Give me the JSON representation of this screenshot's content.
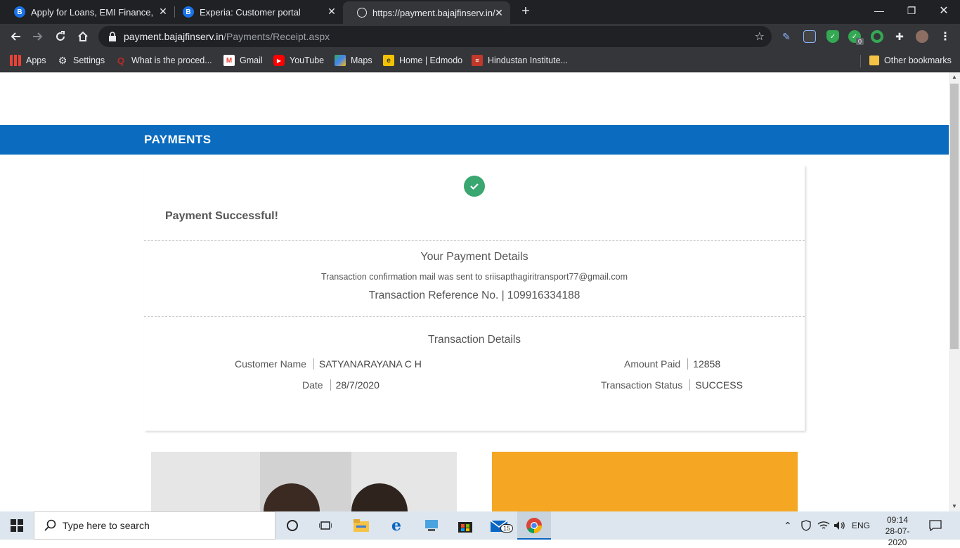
{
  "browser": {
    "tabs": [
      {
        "title": "Apply for Loans, EMI Finance, Cre",
        "favicon": "bajaj-icon"
      },
      {
        "title": "Experia: Customer portal",
        "favicon": "bajaj-icon"
      },
      {
        "title": "https://payment.bajajfinserv.in/P",
        "favicon": "globe-icon"
      }
    ],
    "url_host": "payment.bajajfinserv.in",
    "url_path": "/Payments/Receipt.aspx",
    "bookmarks": [
      {
        "label": "Apps"
      },
      {
        "label": "Settings"
      },
      {
        "label": "What is the proced..."
      },
      {
        "label": "Gmail"
      },
      {
        "label": "YouTube"
      },
      {
        "label": "Maps"
      },
      {
        "label": "Home | Edmodo"
      },
      {
        "label": "Hindustan Institute..."
      }
    ],
    "other_bookmarks": "Other bookmarks",
    "extension_badge": "0"
  },
  "page": {
    "banner_title": "PAYMENTS",
    "status_heading": "Payment Successful!",
    "details_heading": "Your Payment Details",
    "mail_note": "Transaction confirmation mail was sent to sriisapthagiritransport77@gmail.com",
    "reference": "Transaction Reference No. | 109916334188",
    "transaction_heading": "Transaction Details",
    "fields": {
      "customer_name_label": "Customer Name",
      "customer_name": "SATYANARAYANA C H",
      "date_label": "Date",
      "date": "28/7/2020",
      "amount_label": "Amount Paid",
      "amount": "12858",
      "status_label": "Transaction Status",
      "status": "SUCCESS"
    },
    "accent_color": "#0b6cbf",
    "success_color": "#3aa670"
  },
  "taskbar": {
    "search_placeholder": "Type here to search",
    "mail_badge": "15",
    "language": "ENG",
    "time": "09:14",
    "date": "28-07-2020"
  }
}
